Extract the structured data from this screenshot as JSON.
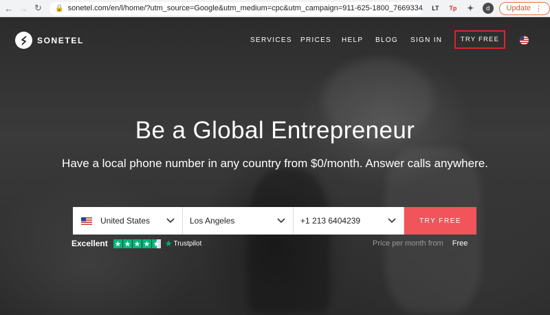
{
  "browser": {
    "url": "sonetel.com/en/l/home/?utm_source=Google&utm_medium=cpc&utm_campaign=911-625-1800_76693342...",
    "avatar_letter": "d",
    "update_label": "Update",
    "ext_lt": "LT",
    "ext_tp": "Tp"
  },
  "header": {
    "logo_text": "SONETEL",
    "nav": [
      {
        "label": "SERVICES"
      },
      {
        "label": "PRICES"
      },
      {
        "label": "HELP"
      },
      {
        "label": "BLOG"
      },
      {
        "label": "SIGN IN"
      }
    ],
    "try_free": "TRY FREE"
  },
  "hero": {
    "title": "Be a Global Entrepreneur",
    "subtitle": "Have a local phone number in any country from $0/month. Answer calls anywhere."
  },
  "form": {
    "country": "United States",
    "city": "Los Angeles",
    "number": "+1 213 6404239",
    "cta": "TRY FREE"
  },
  "trust": {
    "label": "Excellent",
    "brand": "Trustpilot",
    "rating_stars": 4.5
  },
  "price": {
    "label": "Price per month from",
    "value": "Free"
  },
  "colors": {
    "accent": "#f2545b",
    "trustpilot": "#00b67a",
    "highlight_border": "#d9262a"
  }
}
